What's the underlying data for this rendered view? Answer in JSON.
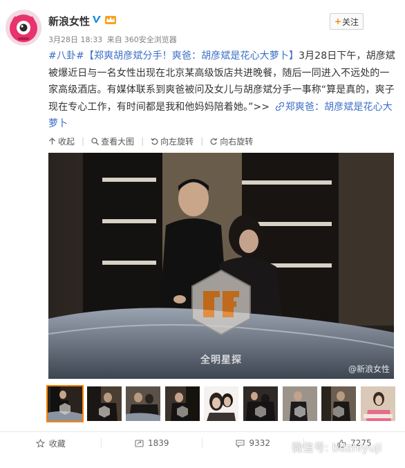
{
  "post": {
    "user_name": "新浪女性",
    "follow_label": "关注",
    "date": "3月28日 18:33",
    "source_prefix": "来自",
    "source": "360安全浏览器",
    "hashtag": "#八卦#",
    "title_link": "【郑爽胡彦斌分手！爽爸：胡彦斌是花心大萝卜】",
    "body": "3月28日下午，胡彦斌被爆近日与一名女性出现在北京某高级饭店共进晚餐，随后一同进入不远处的一家高级酒店。有媒体联系到爽爸被问及女儿与胡彦斌分手一事称“算是真的，爽子现在专心工作，有时间都是我和他妈妈陪着她。”>>",
    "article_link": "郑爽爸：胡彦斌是花心大萝卜"
  },
  "toolbar": {
    "collapse": "收起",
    "view_large": "查看大图",
    "rotate_left": "向左旋转",
    "rotate_right": "向右旋转"
  },
  "photo": {
    "brand_watermark": "全明星探",
    "source_watermark": "@新浪女性"
  },
  "thumbnails": {
    "count": 9,
    "active_index": 0
  },
  "footer": {
    "favorite": "收藏",
    "repost_count": "1839",
    "comment_count": "9332",
    "like_count": "7275"
  },
  "overlay": {
    "wechat_watermark": "微信号: bdzhiyuji"
  },
  "colors": {
    "accent": "#ff8200",
    "link": "#3a6ec6",
    "text": "#333333",
    "muted": "#808080"
  }
}
